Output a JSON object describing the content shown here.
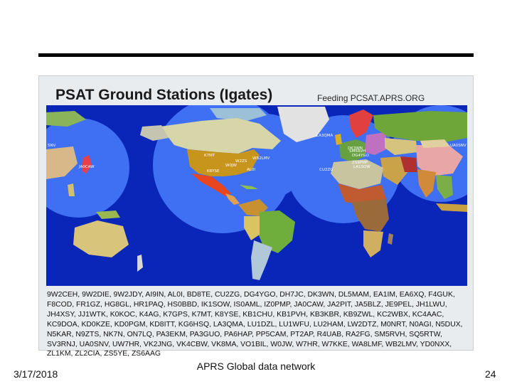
{
  "slide": {
    "date": "3/17/2018",
    "caption": "APRS Global data network",
    "page_number": "24"
  },
  "map": {
    "title": "PSAT Ground Stations (Igates)",
    "subtitle": "Feeding PCSAT.APRS.ORG",
    "colors": {
      "ocean": "#0a26b8",
      "coverage": "#3f6ff2",
      "outer_frame": "#e9ecef"
    },
    "station_labels": [
      "SNV",
      "JA0CAW",
      "K7MT",
      "W2ZS",
      "WB2LMV",
      "W0JW",
      "K8YSE",
      "AL0I",
      "LA3QMA",
      "DK3WN",
      "DG4YGO",
      "SM5RVH",
      "ZS9PMP",
      "LA1SOW",
      "CU2ZG",
      "UA0SNV"
    ]
  },
  "callsigns": "9W2CEH, 9W2DIE, 9W2JDY, AI9IN, AL0I, BD8TE, CU2ZG, DG4YGO, DH7JC, DK3WN, DL5MAM, EA1IM, EA6XQ, F4GUK, F8COD, FR1GZ, HG8GL, HR1PAQ, HS0BBD, IK1SOW, IS0AML, IZ0PMP, JA0CAW, JA2PIT, JA5BLZ, JE9PEL, JH1LWU, JH4XSY, JJ1WTK, K0KOC, K4AG, K7GPS, K7MT, K8YSE, KB1CHU, KB1PVH, KB3KBR, KB9ZWL, KC2WBX, KC4AAC, KC9DOA, KD0KZE, KD0PGM, KD8ITT, KG6HSQ, LA3QMA, LU1DZL, LU1WFU, LU2HAM, LW2DTZ, M0NRT, N0AGI, N5DUX, N5KAR, N9ZTS, NK7N, ON7LQ, PA3EKM, PA3GUO, PA6HAP, PP5CAM, PT2AP, R4UAB, RA2FG, SM5RVH, SQ5RTW, SV3RNJ, UA0SNV, UW7HR, VK2JNG, VK4CBW, VK8MA, VO1BIL, W0JW, W7HR, W7KKE, WA8LMF, WB2LMV, YD0NXX, ZL1KM, ZL2CIA, ZS5YE, ZS6AAG"
}
